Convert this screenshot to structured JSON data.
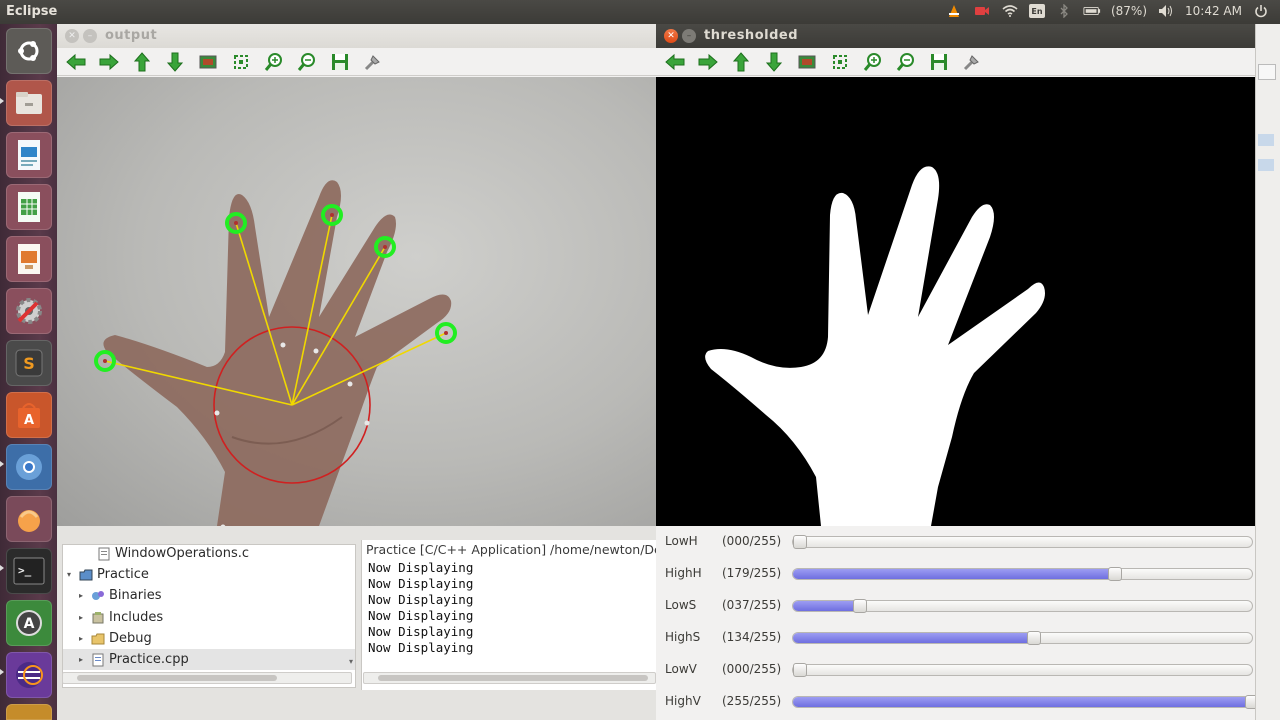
{
  "top_panel": {
    "app_title": "Eclipse",
    "battery": "(87%)",
    "clock": "10:42 AM",
    "keyboard_layout": "En",
    "icons": [
      "vlc-icon",
      "camera-icon",
      "wifi-icon",
      "keyboard-icon",
      "bluetooth-icon",
      "battery-icon",
      "volume-icon",
      "power-icon"
    ]
  },
  "launcher": {
    "items": [
      "ubuntu-dash",
      "files",
      "writer",
      "calc",
      "impress",
      "settings",
      "sublime-text",
      "software-center",
      "chromium",
      "clementine",
      "terminal",
      "ubuntu-one",
      "sticky"
    ]
  },
  "output_window": {
    "title": "output",
    "toolbar": [
      "pan-left",
      "pan-right",
      "pan-up",
      "pan-down",
      "zoom-fit",
      "zoom-original",
      "zoom-in",
      "zoom-out",
      "save",
      "properties"
    ]
  },
  "thresholded_window": {
    "title": "thresholded",
    "sliders": [
      {
        "name": "LowH",
        "value": "(000/255)",
        "level": 0
      },
      {
        "name": "HighH",
        "value": "(179/255)",
        "level": 0.702
      },
      {
        "name": "LowS",
        "value": "(037/255)",
        "level": 0.145
      },
      {
        "name": "HighS",
        "value": "(134/255)",
        "level": 0.525
      },
      {
        "name": "LowV",
        "value": "(000/255)",
        "level": 0
      },
      {
        "name": "HighV",
        "value": "(255/255)",
        "level": 1.0
      }
    ]
  },
  "eclipse": {
    "tree": [
      {
        "label": "WindowOperations.c",
        "arrow": ""
      },
      {
        "label": "Practice",
        "arrow": "▾"
      },
      {
        "label": "Binaries",
        "arrow": "▸"
      },
      {
        "label": "Includes",
        "arrow": "▸"
      },
      {
        "label": "Debug",
        "arrow": "▸"
      },
      {
        "label": "Practice.cpp",
        "arrow": "▸"
      }
    ],
    "console_header": "Practice [C/C++ Application] /home/newton/De",
    "console_lines": [
      "Now Displaying",
      "Now Displaying",
      "Now Displaying",
      "Now Displaying",
      "Now Displaying",
      "Now Displaying"
    ]
  },
  "colors": {
    "slider_fill": "#7b7be6",
    "fingertip_marker": "#22ee22",
    "finger_line": "#f0d800",
    "palm_circle": "#d02020"
  }
}
